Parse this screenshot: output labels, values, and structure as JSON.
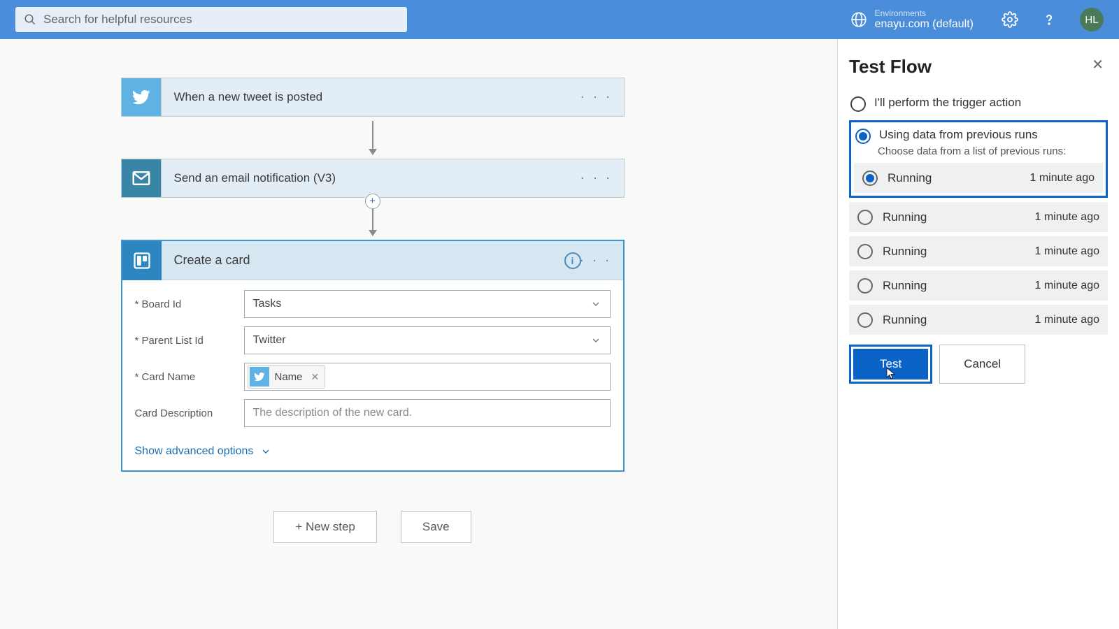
{
  "header": {
    "search_placeholder": "Search for helpful resources",
    "env_label": "Environments",
    "env_value": "enayu.com (default)",
    "avatar_initials": "HL"
  },
  "flow": {
    "step1_label": "When a new tweet is posted",
    "step2_label": "Send an email notification (V3)",
    "step3_label": "Create a card",
    "form": {
      "board_id_label": "Board Id",
      "board_id_value": "Tasks",
      "parent_list_label": "Parent List Id",
      "parent_list_value": "Twitter",
      "card_name_label": "Card Name",
      "card_name_token": "Name",
      "card_desc_label": "Card Description",
      "card_desc_placeholder": "The description of the new card.",
      "advanced_link": "Show advanced options"
    },
    "new_step_label": "+ New step",
    "save_label": "Save"
  },
  "panel": {
    "title": "Test Flow",
    "opt1": "I'll perform the trigger action",
    "opt2": "Using data from previous runs",
    "opt2_sub": "Choose data from a list of previous runs:",
    "runs": [
      {
        "status": "Running",
        "time": "1 minute ago",
        "selected": true
      },
      {
        "status": "Running",
        "time": "1 minute ago",
        "selected": false
      },
      {
        "status": "Running",
        "time": "1 minute ago",
        "selected": false
      },
      {
        "status": "Running",
        "time": "1 minute ago",
        "selected": false
      },
      {
        "status": "Running",
        "time": "1 minute ago",
        "selected": false
      }
    ],
    "test_btn": "Test",
    "cancel_btn": "Cancel"
  }
}
